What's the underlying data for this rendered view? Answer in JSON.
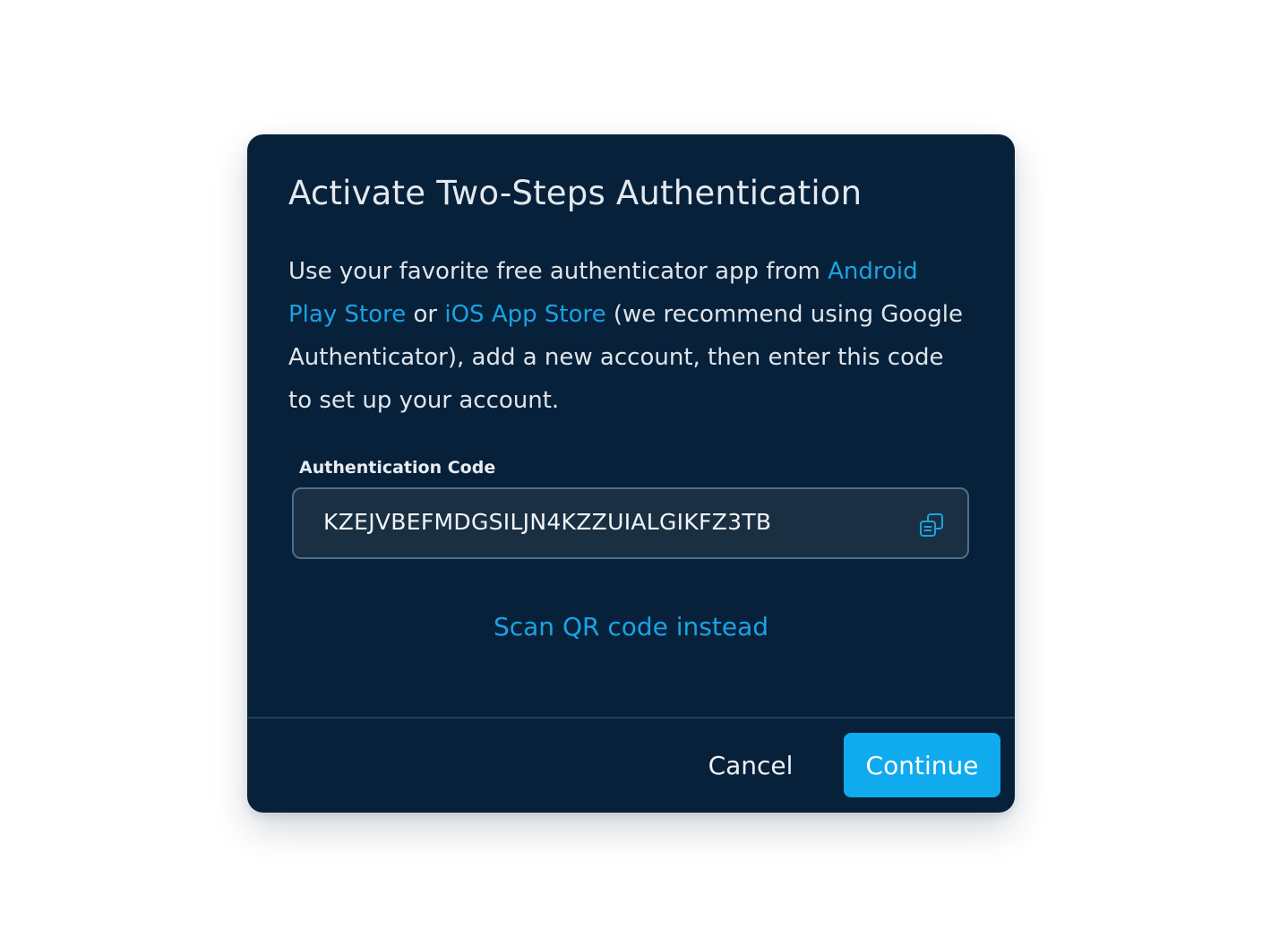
{
  "dialog": {
    "title": "Activate Two-Steps Authentication",
    "description": {
      "part1": "Use your favorite free authenticator app from ",
      "android_link": "Android Play Store",
      "part2": " or ",
      "ios_link": "iOS App Store",
      "part3": " (we recommend using Google Authenticator), add a new account, then enter this code to set up your account."
    },
    "code_label": "Authentication Code",
    "code_value": "KZEJVBEFMDGSILJN4KZZUIALGIKFZ3TB",
    "copy_icon": "copy-icon",
    "scan_link": "Scan QR code instead",
    "cancel_label": "Cancel",
    "continue_label": "Continue"
  },
  "colors": {
    "modal_background": "#07213a",
    "link": "#1aa3e3",
    "primary_button": "#10aaee",
    "field_background": "#1a3042",
    "field_border": "#4b6f8e",
    "page_background": "#ffffff"
  }
}
